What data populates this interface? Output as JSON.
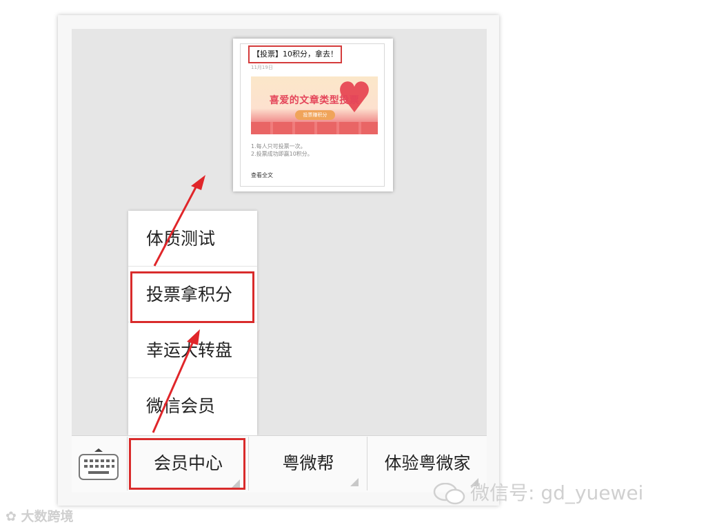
{
  "article": {
    "title": "【投票】10积分，拿去！",
    "date": "11月19日",
    "banner_title": "喜爱的文章类型投票",
    "banner_tag": "投票赚积分",
    "desc_line1": "1.每人只可投票一次。",
    "desc_line2": "2.投票成功即赢10积分。",
    "read_more": "查看全文"
  },
  "submenu": {
    "items": [
      {
        "label": "体质测试"
      },
      {
        "label": "投票拿积分"
      },
      {
        "label": "幸运大转盘"
      },
      {
        "label": "微信会员"
      }
    ]
  },
  "bottom_menu": {
    "keyboard_icon": "keyboard-icon",
    "items": [
      {
        "label": "会员中心"
      },
      {
        "label": "粤微帮"
      },
      {
        "label": "体验粤微家"
      }
    ]
  },
  "watermark": "微信号: gd_yuewei",
  "corner_logo": "大数跨境",
  "colors": {
    "highlight": "#d92b2b",
    "arrow": "#e0262a"
  }
}
